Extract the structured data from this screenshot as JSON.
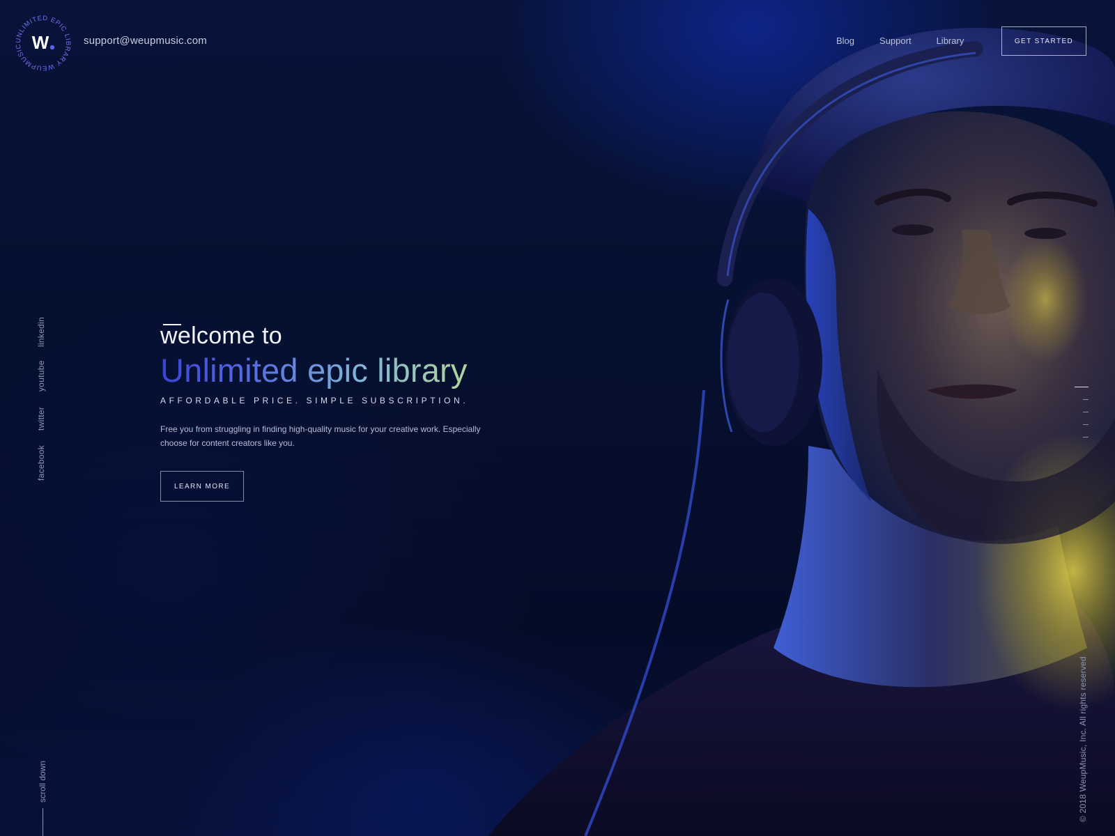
{
  "brand": {
    "logo_mark": "W.",
    "logo_ring_text": "UNLIMITED EPIC LIBRARY WEUPMUSIC",
    "accent_color": "#5b5fe6"
  },
  "header": {
    "email": "support@weupmusic.com",
    "nav": [
      {
        "label": "Blog"
      },
      {
        "label": "Support"
      },
      {
        "label": "Library"
      }
    ],
    "cta_label": "GET STARTED"
  },
  "social": {
    "links": [
      {
        "label": "linkedin"
      },
      {
        "label": "youtube"
      },
      {
        "label": "twitter"
      },
      {
        "label": "facebook"
      }
    ],
    "scroll_label": "scroll down"
  },
  "hero": {
    "welcome": "welcome to",
    "headline": "Unlimited epic library",
    "tagline": "AFFORDABLE PRICE. SIMPLE SUBSCRIPTION.",
    "description": "Free you from struggling in finding high-quality music for your creative work. Especially choose for content creators like you.",
    "button_label": "LEARN MORE",
    "headline_gradient": [
      "#3b43d6",
      "#5c73e0",
      "#7fb4d8",
      "#b9dc8f"
    ]
  },
  "footer": {
    "copyright": "© 2018 WeupMusic, Inc. All rights reserved"
  },
  "hero_image": {
    "subject": "man-with-headphones-and-beanie"
  }
}
